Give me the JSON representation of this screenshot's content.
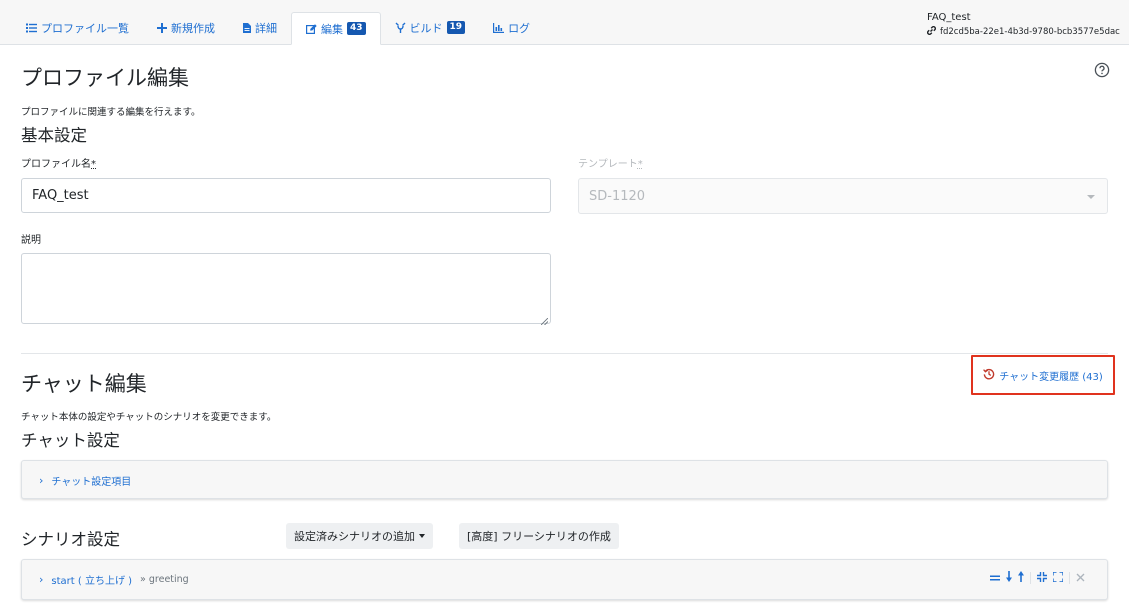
{
  "tabs": [
    {
      "label": "プロファイル一覧",
      "icon": "list-icon"
    },
    {
      "label": "新規作成",
      "icon": "plus-icon"
    },
    {
      "label": "詳細",
      "icon": "document-icon"
    },
    {
      "label": "編集",
      "icon": "edit-icon",
      "badge": "43",
      "active": true
    },
    {
      "label": "ビルド",
      "icon": "build-icon",
      "badge": "19"
    },
    {
      "label": "ログ",
      "icon": "bar-chart-icon"
    }
  ],
  "profile": {
    "name": "FAQ_test",
    "id": "fd2cd5ba-22e1-4b3d-9780-bcb3577e5dac"
  },
  "profile_edit": {
    "title": "プロファイル編集",
    "description": "プロファイルに関連する編集を行えます。",
    "basic_settings_title": "基本設定",
    "profile_name_label": "プロファイル名",
    "profile_name_value": "FAQ_test",
    "template_label": "テンプレート",
    "template_value": "SD-1120",
    "required_mark": "*",
    "description_label": "説明",
    "description_value": ""
  },
  "chat_edit": {
    "title": "チャット編集",
    "description": "チャット本体の設定やチャットのシナリオを変更できます。",
    "history_link": "チャット変更履歴 (43)",
    "chat_settings_title": "チャット設定",
    "chat_settings_item": "チャット設定項目"
  },
  "scenario": {
    "title": "シナリオ設定",
    "add_button": "設定済みシナリオの追加",
    "create_button": "[高度] フリーシナリオの作成",
    "items": [
      {
        "label": "start ( 立ち上げ )",
        "sub": "» greeting"
      }
    ]
  },
  "colors": {
    "link": "#1f6fd1",
    "badge": "#1558b0",
    "highlight_border": "#e0331e"
  }
}
